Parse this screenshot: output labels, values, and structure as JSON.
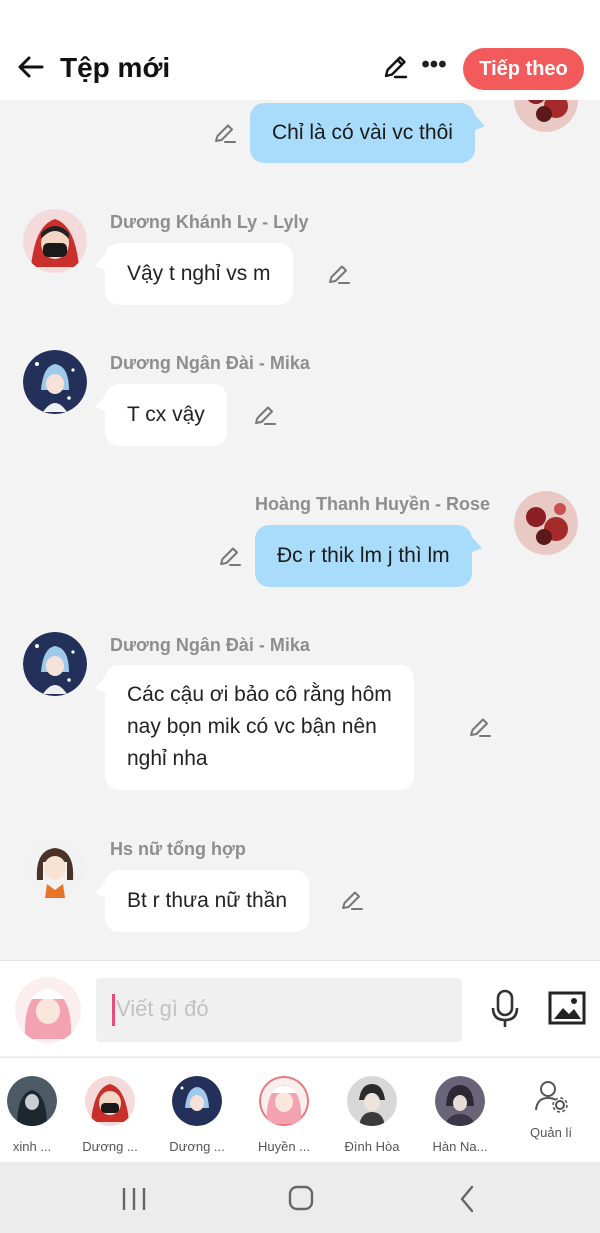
{
  "header": {
    "title": "Tệp mới",
    "next_label": "Tiếp theo"
  },
  "messages": [
    {
      "text": "Chỉ là có vài vc thôi"
    },
    {
      "sender": "Dương Khánh Ly - Lyly",
      "text": "Vậy t nghỉ vs m"
    },
    {
      "sender": "Dương Ngân Đài - Mika",
      "text": "T cx vậy"
    },
    {
      "sender": "Hoàng Thanh Huyền - Rose",
      "text": "Đc r thik lm j thì lm"
    },
    {
      "sender": "Dương Ngân Đài - Mika",
      "lines": [
        "Các cậu ơi bảo cô rằng hôm",
        "nay bọn mik có vc bận nên",
        "nghỉ nha"
      ]
    },
    {
      "sender": "Hs nữ tổng hợp",
      "text": "Bt r thưa nữ thần"
    }
  ],
  "input": {
    "placeholder": "Viết gì đó"
  },
  "members": [
    {
      "name": "xinh ..."
    },
    {
      "name": "Dương ..."
    },
    {
      "name": "Dương ..."
    },
    {
      "name": "Huyền ..."
    },
    {
      "name": "Đình Hòa"
    },
    {
      "name": "Hàn Na..."
    }
  ],
  "manage_label": "Quản lí",
  "colors": {
    "accent": "#f25a5b",
    "own_bubble": "#a8dcfa",
    "other_bubble": "#ffffff",
    "background": "#f3f3f3"
  },
  "icons": [
    "back-arrow-icon",
    "pencil-icon",
    "more-icon",
    "microphone-icon",
    "image-icon",
    "manage-user-icon",
    "recent-apps-icon",
    "home-icon",
    "back-icon"
  ]
}
